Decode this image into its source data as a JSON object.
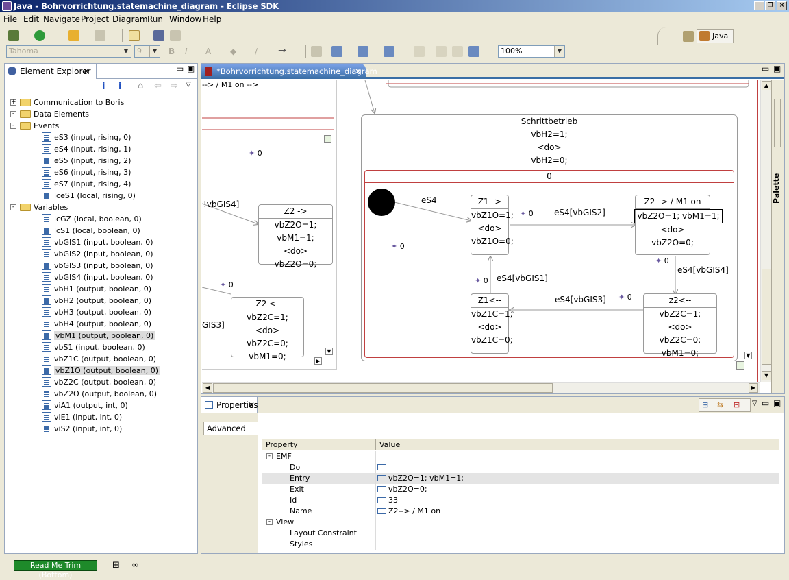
{
  "window": {
    "title": "Java - Bohrvorrichtung.statemachine_diagram - Eclipse SDK"
  },
  "menu": [
    "File",
    "Edit",
    "Navigate",
    "Project",
    "Diagram",
    "Run",
    "Window",
    "Help"
  ],
  "toolbar": {
    "font_name": "Tahoma",
    "font_size": "9",
    "zoom": "100%",
    "perspective": "Java"
  },
  "explorer": {
    "title": "Element Explorer",
    "items": [
      {
        "label": "Communication to Boris",
        "type": "folder",
        "level": 0,
        "expand": "+"
      },
      {
        "label": "Data Elements",
        "type": "folder",
        "level": 0,
        "expand": "-"
      },
      {
        "label": "Events",
        "type": "folder",
        "level": 1,
        "expand": "-"
      },
      {
        "label": "eS3 (input, rising, 0)",
        "type": "var",
        "level": 2
      },
      {
        "label": "eS4 (input, rising, 1)",
        "type": "var",
        "level": 2
      },
      {
        "label": "eS5 (input, rising, 2)",
        "type": "var",
        "level": 2
      },
      {
        "label": "eS6 (input, rising, 3)",
        "type": "var",
        "level": 2
      },
      {
        "label": "eS7 (input, rising, 4)",
        "type": "var",
        "level": 2
      },
      {
        "label": "lceS1 (local, rising, 0)",
        "type": "var",
        "level": 2
      },
      {
        "label": "Variables",
        "type": "folder",
        "level": 1,
        "expand": "-"
      },
      {
        "label": "lcGZ (local, boolean, 0)",
        "type": "var",
        "level": 2
      },
      {
        "label": "lcS1 (local, boolean, 0)",
        "type": "var",
        "level": 2
      },
      {
        "label": "vbGIS1 (input, boolean, 0)",
        "type": "var",
        "level": 2
      },
      {
        "label": "vbGIS2 (input, boolean, 0)",
        "type": "var",
        "level": 2
      },
      {
        "label": "vbGIS3 (input, boolean, 0)",
        "type": "var",
        "level": 2
      },
      {
        "label": "vbGIS4 (input, boolean, 0)",
        "type": "var",
        "level": 2
      },
      {
        "label": "vbH1 (output, boolean, 0)",
        "type": "var",
        "level": 2
      },
      {
        "label": "vbH2 (output, boolean, 0)",
        "type": "var",
        "level": 2
      },
      {
        "label": "vbH3 (output, boolean, 0)",
        "type": "var",
        "level": 2
      },
      {
        "label": "vbH4 (output, boolean, 0)",
        "type": "var",
        "level": 2
      },
      {
        "label": "vbM1 (output, boolean, 0)",
        "type": "var",
        "level": 2,
        "selected": true
      },
      {
        "label": "vbS1 (input, boolean, 0)",
        "type": "var",
        "level": 2
      },
      {
        "label": "vbZ1C (output, boolean, 0)",
        "type": "var",
        "level": 2
      },
      {
        "label": "vbZ1O (output, boolean, 0)",
        "type": "var",
        "level": 2,
        "selected": true
      },
      {
        "label": "vbZ2C (output, boolean, 0)",
        "type": "var",
        "level": 2
      },
      {
        "label": "vbZ2O (output, boolean, 0)",
        "type": "var",
        "level": 2
      },
      {
        "label": "viA1 (output, int, 0)",
        "type": "var",
        "level": 2
      },
      {
        "label": "viE1 (input, int, 0)",
        "type": "var",
        "level": 2
      },
      {
        "label": "viS2 (input, int, 0)",
        "type": "var",
        "level": 2
      }
    ]
  },
  "editor": {
    "tab": "*Bohrvorrichtung.statemachine_diagram",
    "palette": "Palette"
  },
  "diagram": {
    "schritt": {
      "name": "Schrittbetrieb",
      "l1": "vbH2=1;",
      "l2": "<do>",
      "l3": "vbH2=0;",
      "region": "0"
    },
    "z1open": {
      "title": "Z1-->",
      "l1": "vbZ1O=1;",
      "l2": "<do>",
      "l3": "vbZ1O=0;"
    },
    "z2open": {
      "title": "Z2--> / M1 on",
      "l1": "vbZ2O=1; vbM1=1;",
      "l2": "<do>",
      "l3": "vbZ2O=0;"
    },
    "z1close": {
      "title": "Z1<--",
      "l1": "vbZ1C=1;",
      "l2": "<do>",
      "l3": "vbZ1C=0;"
    },
    "z2close": {
      "title": "z2<--",
      "l1": "vbZ2C=1;",
      "l2": "<do>",
      "l3": "vbZ2C=0; vbM1=0;"
    },
    "left_z2open": {
      "title": "Z2 ->",
      "l1": "vbZ2O=1; vbM1=1;",
      "l2": "<do>",
      "l3": "vbZ2O=0;"
    },
    "left_z2close": {
      "title": "Z2 <-",
      "l1": "vbZ2C=1;",
      "l2": "<do>",
      "l3": "vbZ2C=0; vbM1=0;"
    },
    "labels": {
      "es4": "eS4",
      "es4_gis2": "eS4[vbGIS2]",
      "es4_gis4": "eS4[vbGIS4]",
      "es4_gis3": "eS4[vbGIS3]",
      "es4_gis1": "eS4[vbGIS1]",
      "left_gis4": "!vbGIS4]",
      "left_gis3": "GIS3]",
      "zero": "0"
    }
  },
  "properties": {
    "title": "Properties",
    "tab": "Advanced",
    "col_property": "Property",
    "col_value": "Value",
    "rows": [
      {
        "label": "EMF",
        "group": true
      },
      {
        "label": "Do",
        "value": ""
      },
      {
        "label": "Entry",
        "value": "vbZ2O=1; vbM1=1;",
        "selected": true
      },
      {
        "label": "Exit",
        "value": "vbZ2O=0;"
      },
      {
        "label": "Id",
        "value": "33"
      },
      {
        "label": "Name",
        "value": "Z2--> / M1 on"
      },
      {
        "label": "View",
        "group": true
      },
      {
        "label": "Layout Constraint",
        "value": ""
      },
      {
        "label": "Styles",
        "value": ""
      }
    ]
  },
  "status": {
    "trim": "Read Me Trim (Bottom)"
  }
}
